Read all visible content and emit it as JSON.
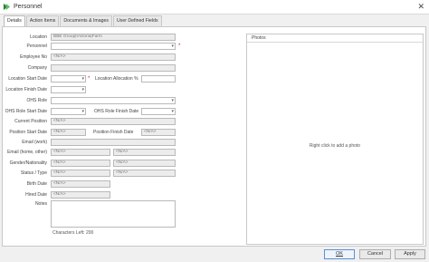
{
  "window": {
    "title": "Personnel"
  },
  "tabs": [
    {
      "label": "Details",
      "active": true
    },
    {
      "label": "Action Items"
    },
    {
      "label": "Documents & Images"
    },
    {
      "label": "User Defined Fields"
    }
  ],
  "form": {
    "location": {
      "label": "Location",
      "value": "BBE Group|Victoria|Farm"
    },
    "personnel": {
      "label": "Personnel",
      "value": ""
    },
    "employee_no": {
      "label": "Employee No",
      "value": "<N/A>"
    },
    "company": {
      "label": "Company",
      "value": ""
    },
    "location_start_date": {
      "label": "Location Start Date",
      "value": ""
    },
    "location_allocation": {
      "label": "Location Allocation %",
      "value": ""
    },
    "location_finish_date": {
      "label": "Location Finish Date",
      "value": ""
    },
    "ohs_role": {
      "label": "OHS Role",
      "value": ""
    },
    "ohs_role_start_date": {
      "label": "OHS Role Start Date",
      "value": ""
    },
    "ohs_role_finish_date": {
      "label": "OHS Role Finish Date",
      "value": ""
    },
    "current_position": {
      "label": "Current Position",
      "value": "<N/A>"
    },
    "position_start_date": {
      "label": "Position Start Date",
      "value": "<N/A>"
    },
    "position_finish_date": {
      "label": "Position Finish Date",
      "value": "<N/A>"
    },
    "email_work": {
      "label": "Email (work)",
      "value": ""
    },
    "email_home": {
      "label": "Email (home, other)",
      "value": "<N/A>",
      "value2": "<N/A>"
    },
    "gender_nationality": {
      "label": "Gender/Nationality",
      "value": "<N/A>",
      "value2": "<N/A>"
    },
    "status_type": {
      "label": "Status / Type",
      "value": "<N/A>",
      "value2": "<N/A>"
    },
    "birth_date": {
      "label": "Birth Date",
      "value": "<N/A>"
    },
    "hired_date": {
      "label": "Hired Date",
      "value": "<N/A>"
    },
    "notes": {
      "label": "Notes",
      "value": ""
    },
    "characters_left": "Characters Left: 200",
    "required_marker": "*"
  },
  "photos": {
    "title": "Photos",
    "hint": "Right click to add a photo"
  },
  "buttons": {
    "ok": "OK",
    "cancel": "Cancel",
    "apply": "Apply"
  },
  "colors": {
    "accent": "#2e7d32",
    "required": "#d21d1d"
  }
}
